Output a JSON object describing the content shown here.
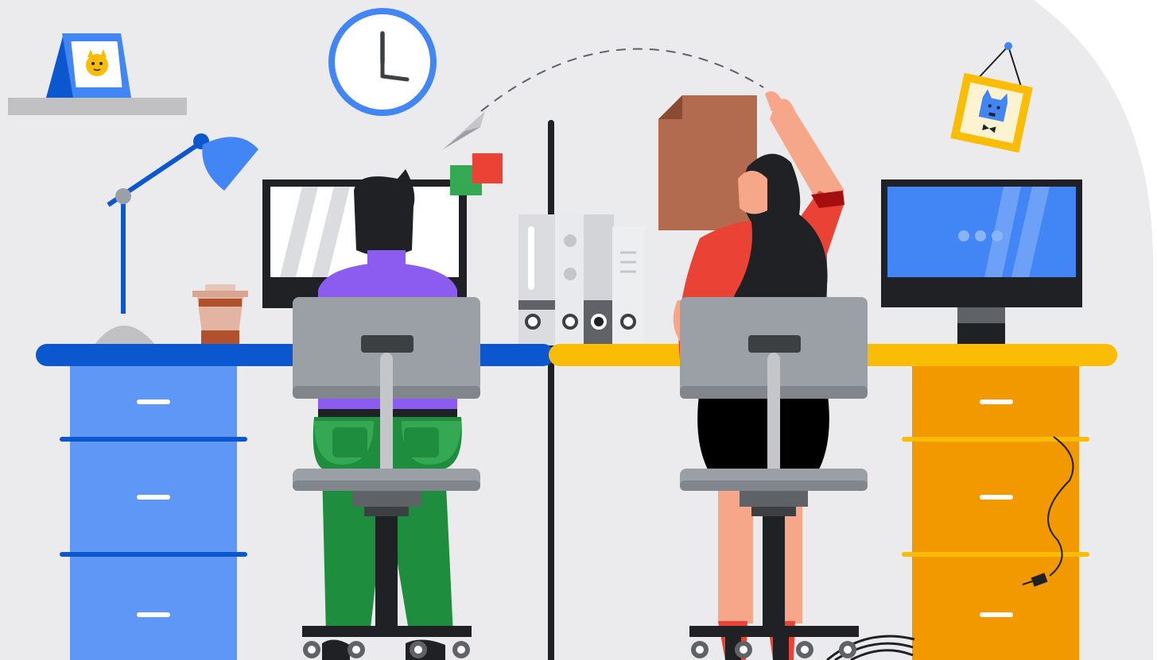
{
  "scene": {
    "colors": {
      "wall": "#ebebed",
      "blue": "#4285f4",
      "blue_dark": "#0b57d0",
      "blue_light": "#5e97f6",
      "yellow": "#fbbc04",
      "orange": "#f29900",
      "green": "#1e8e3e",
      "green_light": "#34a853",
      "red": "#ea4335",
      "purple": "#8c5cf0",
      "grey": "#9aa0a6",
      "grey_dark": "#3c4043",
      "black": "#202124",
      "skin": "#f6a78a",
      "brown": "#b36b50"
    },
    "icons": [
      "cat-picture",
      "dog-picture",
      "wall-clock",
      "desk-lamp",
      "coffee-cup",
      "paper-plane",
      "sticky-notes",
      "binders",
      "paper-sheet",
      "power-plug"
    ],
    "people": [
      "man-at-computer",
      "woman-reaching"
    ],
    "monitor_right_dots": 3
  }
}
